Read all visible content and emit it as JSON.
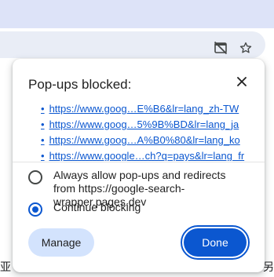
{
  "popup": {
    "title": "Pop-ups blocked:",
    "links": [
      "https://www.goog…E%B6&lr=lang_zh-TW",
      "https://www.goog…5%9B%BD&lr=lang_ja",
      "https://www.goog…A%B0%80&lr=lang_ko",
      "https://www.google…ch?q=pays&lr=lang_fr"
    ],
    "options": [
      {
        "label": "Always allow pop-ups and redirects from https://google-search-wrapper.pages.dev",
        "checked": false
      },
      {
        "label": "Continue blocking",
        "checked": true
      }
    ],
    "manage_label": "Manage",
    "done_label": "Done"
  },
  "page": {
    "left_text": "亚",
    "right_text": "另"
  },
  "icons": {
    "blocked_popup": "popup-blocked-icon",
    "star": "bookmark-star-icon",
    "close": "close-icon"
  },
  "colors": {
    "accent": "#0b57d0",
    "tonal": "#d3e3fd",
    "topbar": "#dde3f8"
  }
}
